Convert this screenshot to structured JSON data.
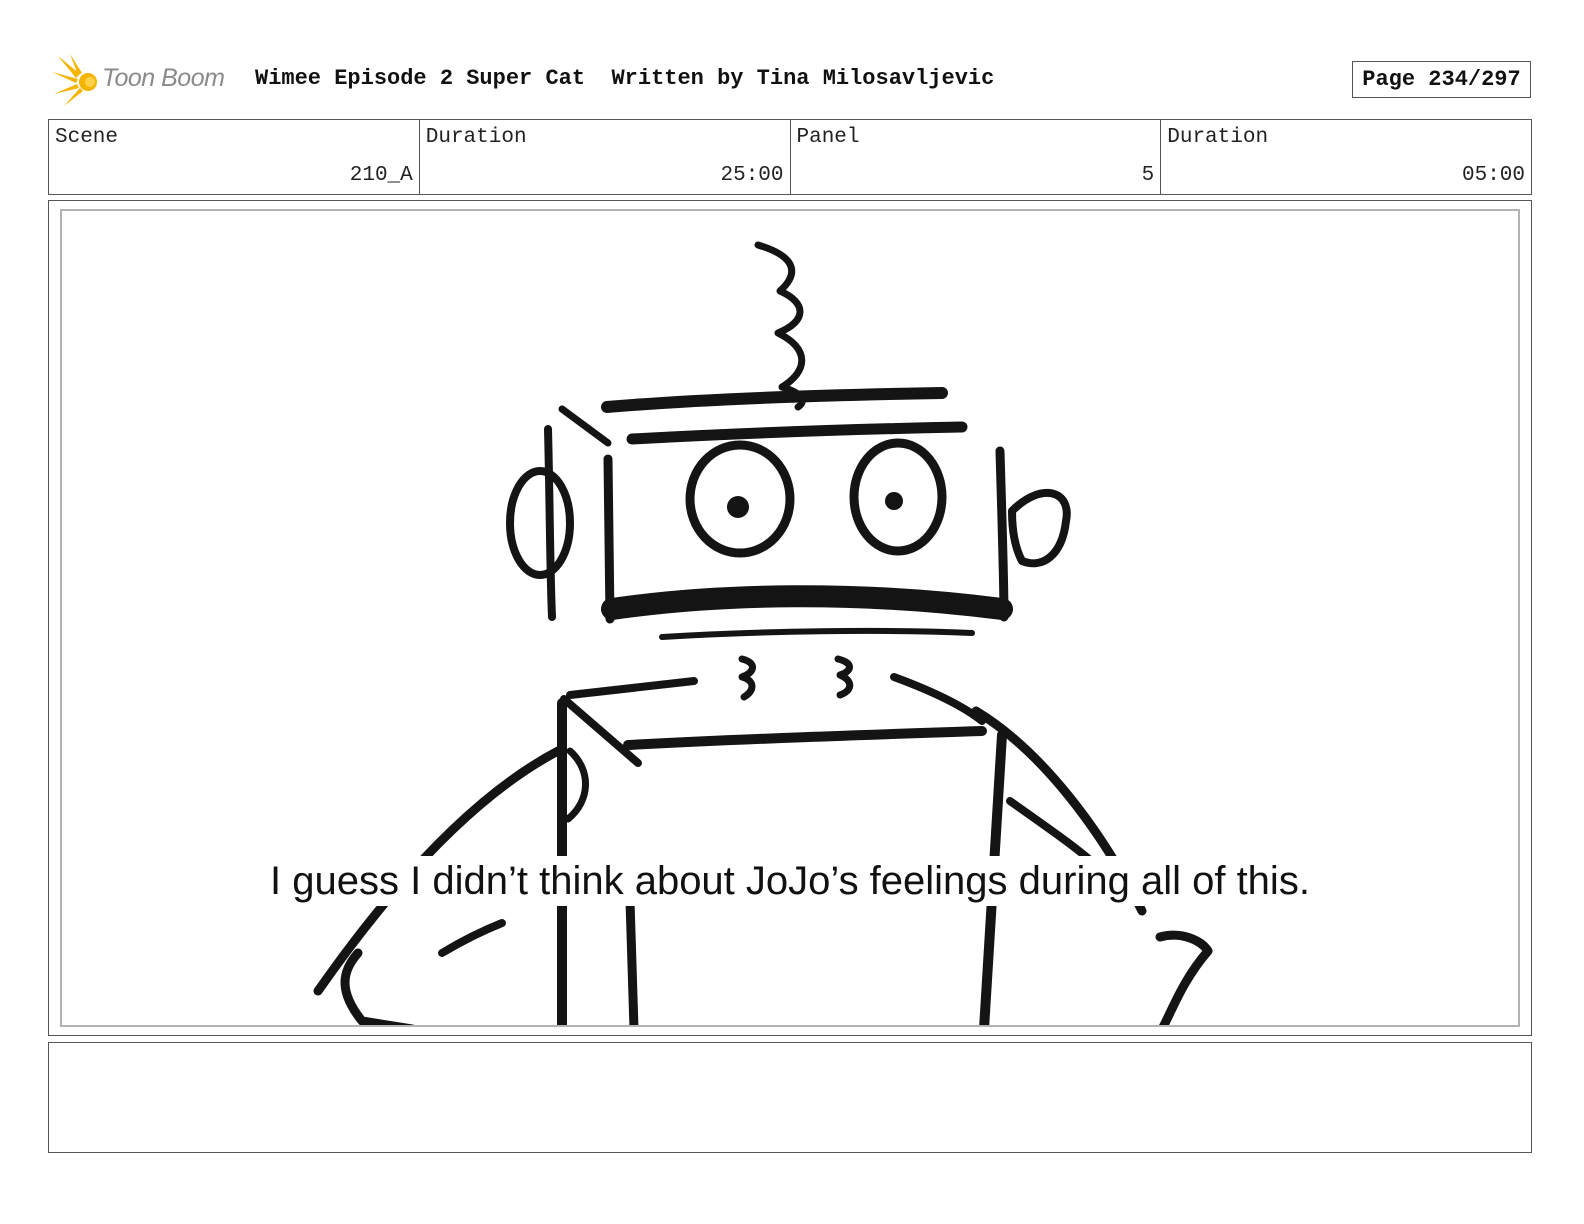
{
  "header": {
    "logo_text": "Toon Boom",
    "title": "Wimee Episode 2 Super Cat  Written by Tina Milosavljevic",
    "page": "Page 234/297"
  },
  "info": {
    "scene_label": "Scene",
    "scene_value": "210_A",
    "scene_duration_label": "Duration",
    "scene_duration_value": "25:00",
    "panel_label": "Panel",
    "panel_value": "5",
    "panel_duration_label": "Duration",
    "panel_duration_value": "05:00"
  },
  "panel": {
    "dialogue": "I guess I didn’t think about JoJo’s feelings during all of this."
  },
  "colors": {
    "logo_star": "#f5b400",
    "sketch_ink": "#141414"
  }
}
